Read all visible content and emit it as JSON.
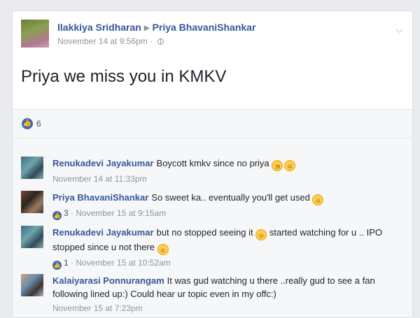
{
  "post": {
    "author": "Ilakkiya Sridharan",
    "recipient": "Priya BhavaniShankar",
    "timestamp": "November 14 at 9:56pm",
    "separator": "·",
    "text": "Priya we miss you in KMKV",
    "like_count": "6"
  },
  "comments": [
    {
      "author": "Renukadevi Jayakumar",
      "text": "Boycott kmkv since no priya",
      "emojis": [
        "crying-face",
        "grinning-face"
      ],
      "timestamp": "November 14 at 11:33pm",
      "likes": ""
    },
    {
      "author": "Priya BhavaniShankar",
      "text": "So sweet ka.. eventually you'll get used",
      "emojis": [
        "grinning-face"
      ],
      "timestamp": "November 15 at 9:15am",
      "likes": "3"
    },
    {
      "author": "Renukadevi Jayakumar",
      "text_part1": "but no stopped seeing it",
      "text_part2": "started watching for u .. IPO stopped since u not there",
      "emojis": [
        "grinning-face",
        "grinning-face"
      ],
      "timestamp": "November 15 at 10:52am",
      "likes": "1"
    },
    {
      "author": "Kalaiyarasi Ponnurangam",
      "text": "It was gud watching u there ..really gud to see a fan following lined up:) Could hear ur topic even in my offc:)",
      "timestamp": "November 15 at 7:23pm",
      "likes": ""
    }
  ],
  "colors": {
    "link": "#365899",
    "meta": "#90949c",
    "like": "#4267b2"
  }
}
